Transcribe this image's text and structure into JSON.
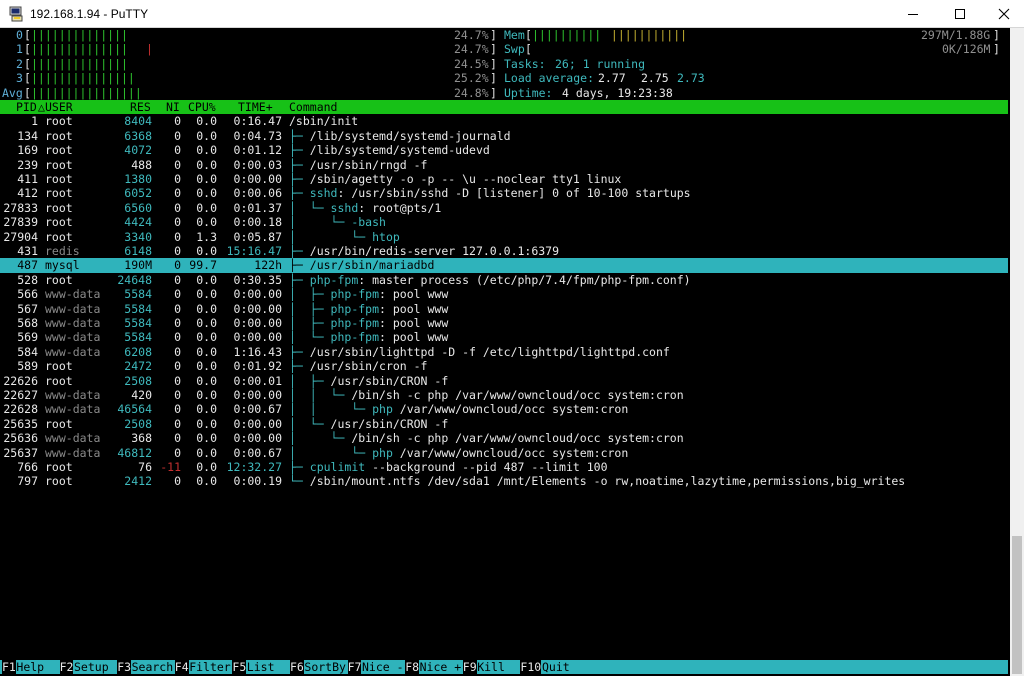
{
  "window": {
    "title": "192.168.1.94 - PuTTY"
  },
  "colors": {
    "header_bg": "#17c117",
    "selected_bg": "#2fb3bb",
    "accent": "#3fb9bd",
    "bar_green": "#2ec42e",
    "bar_red": "#c43030",
    "bar_yellow": "#c4b030"
  },
  "meters": {
    "cpus": [
      {
        "label": "0",
        "green": "||||||||||||||",
        "red": "",
        "pct": "24.7%"
      },
      {
        "label": "1",
        "green": "||||||||||||||",
        "red": "|",
        "pct": "24.7%"
      },
      {
        "label": "2",
        "green": "||||||||||||||",
        "red": "",
        "pct": "24.5%"
      },
      {
        "label": "3",
        "green": "|||||||||||||||",
        "red": "",
        "pct": "25.2%"
      }
    ],
    "avg": {
      "label": "Avg",
      "green": "||||||||||||||||",
      "red": "",
      "pct": "24.8%"
    },
    "mem": {
      "label": "Mem",
      "green": "||||||||||",
      "yellow": " |||||||||||",
      "value": "297M/1.88G"
    },
    "swp": {
      "label": "Swp",
      "value": "0K/126M"
    },
    "tasks": {
      "label": "Tasks:",
      "value": "26; 1 running"
    },
    "load": {
      "label": "Load average:",
      "v1": "2.77",
      "v2": "2.75",
      "v3": "2.73"
    },
    "uptime": {
      "label": "Uptime:",
      "value": "4 days, 19:23:38"
    }
  },
  "columns": {
    "pid": "PID",
    "sort": "△",
    "user": "USER",
    "res": "RES",
    "ni": "NI",
    "cpu": "CPU%",
    "time": "TIME+",
    "command": "Command"
  },
  "processes": [
    {
      "pid": "1",
      "user": "root",
      "res": "8404",
      "ni": "0",
      "cpu": "0.0",
      "time": "0:16.47",
      "tree": "",
      "exe": "",
      "cmd": "/sbin/init"
    },
    {
      "pid": "134",
      "user": "root",
      "res": "6368",
      "ni": "0",
      "cpu": "0.0",
      "time": "0:04.73",
      "tree": "├─ ",
      "exe": "",
      "cmd": "/lib/systemd/systemd-journald"
    },
    {
      "pid": "169",
      "user": "root",
      "res": "4072",
      "ni": "0",
      "cpu": "0.0",
      "time": "0:01.12",
      "tree": "├─ ",
      "exe": "",
      "cmd": "/lib/systemd/systemd-udevd"
    },
    {
      "pid": "239",
      "user": "root",
      "res": "488",
      "ni": "0",
      "cpu": "0.0",
      "time": "0:00.03",
      "tree": "├─ ",
      "exe": "",
      "cmd": "/usr/sbin/rngd -f"
    },
    {
      "pid": "411",
      "user": "root",
      "res": "1380",
      "ni": "0",
      "cpu": "0.0",
      "time": "0:00.00",
      "tree": "├─ ",
      "exe": "",
      "cmd": "/sbin/agetty -o -p -- \\u --noclear tty1 linux"
    },
    {
      "pid": "412",
      "user": "root",
      "res": "6052",
      "ni": "0",
      "cpu": "0.0",
      "time": "0:00.06",
      "tree": "├─ ",
      "exe": "sshd",
      "cmd": ": /usr/sbin/sshd -D [listener] 0 of 10-100 startups"
    },
    {
      "pid": "27833",
      "user": "root",
      "res": "6560",
      "ni": "0",
      "cpu": "0.0",
      "time": "0:01.37",
      "tree": "│  └─ ",
      "exe": "sshd",
      "cmd": ": root@pts/1"
    },
    {
      "pid": "27839",
      "user": "root",
      "res": "4424",
      "ni": "0",
      "cpu": "0.0",
      "time": "0:00.18",
      "tree": "│     └─ ",
      "exe": "-bash",
      "cmd": ""
    },
    {
      "pid": "27904",
      "user": "root",
      "res": "3340",
      "ni": "0",
      "cpu": "1.3",
      "time": "0:05.87",
      "tree": "│        └─ ",
      "exe": "htop",
      "cmd": ""
    },
    {
      "pid": "431",
      "user": "redis",
      "res": "6148",
      "ni": "0",
      "cpu": "0.0",
      "time": "15:16.47",
      "tree": "├─ ",
      "exe": "",
      "cmd": "/usr/bin/redis-server 127.0.0.1:6379"
    },
    {
      "pid": "487",
      "user": "mysql",
      "res": "190M",
      "ni": "0",
      "cpu": "99.7",
      "time": "122h",
      "tree": "├─ ",
      "exe": "",
      "cmd": "/usr/sbin/mariadbd"
    },
    {
      "pid": "528",
      "user": "root",
      "res": "24648",
      "ni": "0",
      "cpu": "0.0",
      "time": "0:30.35",
      "tree": "├─ ",
      "exe": "php-fpm",
      "cmd": ": master process (/etc/php/7.4/fpm/php-fpm.conf)"
    },
    {
      "pid": "566",
      "user": "www-data",
      "res": "5584",
      "ni": "0",
      "cpu": "0.0",
      "time": "0:00.00",
      "tree": "│  ├─ ",
      "exe": "php-fpm",
      "cmd": ": pool www"
    },
    {
      "pid": "567",
      "user": "www-data",
      "res": "5584",
      "ni": "0",
      "cpu": "0.0",
      "time": "0:00.00",
      "tree": "│  ├─ ",
      "exe": "php-fpm",
      "cmd": ": pool www"
    },
    {
      "pid": "568",
      "user": "www-data",
      "res": "5584",
      "ni": "0",
      "cpu": "0.0",
      "time": "0:00.00",
      "tree": "│  ├─ ",
      "exe": "php-fpm",
      "cmd": ": pool www"
    },
    {
      "pid": "569",
      "user": "www-data",
      "res": "5584",
      "ni": "0",
      "cpu": "0.0",
      "time": "0:00.00",
      "tree": "│  └─ ",
      "exe": "php-fpm",
      "cmd": ": pool www"
    },
    {
      "pid": "584",
      "user": "www-data",
      "res": "6208",
      "ni": "0",
      "cpu": "0.0",
      "time": "1:16.43",
      "tree": "├─ ",
      "exe": "",
      "cmd": "/usr/sbin/lighttpd -D -f /etc/lighttpd/lighttpd.conf"
    },
    {
      "pid": "589",
      "user": "root",
      "res": "2472",
      "ni": "0",
      "cpu": "0.0",
      "time": "0:01.92",
      "tree": "├─ ",
      "exe": "",
      "cmd": "/usr/sbin/cron -f"
    },
    {
      "pid": "22626",
      "user": "root",
      "res": "2508",
      "ni": "0",
      "cpu": "0.0",
      "time": "0:00.01",
      "tree": "│  ├─ ",
      "exe": "",
      "cmd": "/usr/sbin/CRON -f"
    },
    {
      "pid": "22627",
      "user": "www-data",
      "res": "420",
      "ni": "0",
      "cpu": "0.0",
      "time": "0:00.00",
      "tree": "│  │  └─ ",
      "exe": "",
      "cmd": "/bin/sh -c php /var/www/owncloud/occ system:cron"
    },
    {
      "pid": "22628",
      "user": "www-data",
      "res": "46564",
      "ni": "0",
      "cpu": "0.0",
      "time": "0:00.67",
      "tree": "│  │     └─ ",
      "exe": "php",
      "cmd": " /var/www/owncloud/occ system:cron"
    },
    {
      "pid": "25635",
      "user": "root",
      "res": "2508",
      "ni": "0",
      "cpu": "0.0",
      "time": "0:00.00",
      "tree": "│  └─ ",
      "exe": "",
      "cmd": "/usr/sbin/CRON -f"
    },
    {
      "pid": "25636",
      "user": "www-data",
      "res": "368",
      "ni": "0",
      "cpu": "0.0",
      "time": "0:00.00",
      "tree": "│     └─ ",
      "exe": "",
      "cmd": "/bin/sh -c php /var/www/owncloud/occ system:cron"
    },
    {
      "pid": "25637",
      "user": "www-data",
      "res": "46812",
      "ni": "0",
      "cpu": "0.0",
      "time": "0:00.67",
      "tree": "│        └─ ",
      "exe": "php",
      "cmd": " /var/www/owncloud/occ system:cron"
    },
    {
      "pid": "766",
      "user": "root",
      "res": "76",
      "ni": "-11",
      "cpu": "0.0",
      "time": "12:32.27",
      "tree": "├─ ",
      "exe": "cpulimit",
      "cmd": " --background --pid 487 --limit 100"
    },
    {
      "pid": "797",
      "user": "root",
      "res": "2412",
      "ni": "0",
      "cpu": "0.0",
      "time": "0:00.19",
      "tree": "└─ ",
      "exe": "",
      "cmd": "/sbin/mount.ntfs /dev/sda1 /mnt/Elements -o rw,noatime,lazytime,permissions,big_writes"
    }
  ],
  "footer": [
    {
      "key": "F1",
      "label": "Help"
    },
    {
      "key": "F2",
      "label": "Setup"
    },
    {
      "key": "F3",
      "label": "Search"
    },
    {
      "key": "F4",
      "label": "Filter"
    },
    {
      "key": "F5",
      "label": "List"
    },
    {
      "key": "F6",
      "label": "SortBy"
    },
    {
      "key": "F7",
      "label": "Nice -"
    },
    {
      "key": "F8",
      "label": "Nice +"
    },
    {
      "key": "F9",
      "label": "Kill"
    },
    {
      "key": "F10",
      "label": "Quit"
    }
  ]
}
